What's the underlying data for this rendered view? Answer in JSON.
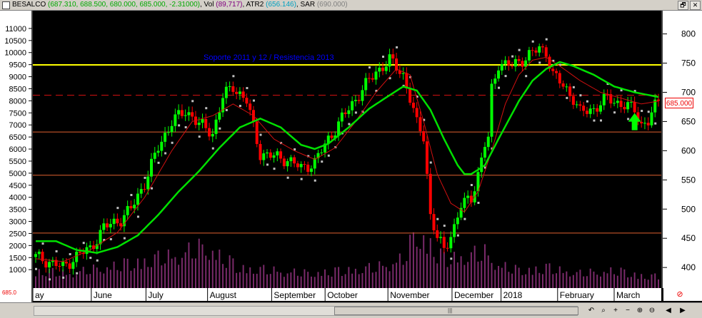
{
  "titlebar": {
    "symbol": "BESALCO",
    "ohlc": "(687.310, 688.500, 680.000, 685.000, -2.31000)",
    "vol_label": ", Vol",
    "vol_value": "(89,717)",
    "atr_label": ", ATR2",
    "atr_value": "(656.146)",
    "sar_label": ", SAR",
    "sar_value": "(690.000)",
    "restore_btn": "🗗",
    "close_btn": "✕"
  },
  "colors": {
    "background": "#000000",
    "up_candle": "#00ff00",
    "down_candle": "#ff0000",
    "volume": "#7a2a6a",
    "long_ma": "#00e000",
    "short_ma": "#d01010",
    "resistance": "#ffff00",
    "support": "#e06030",
    "annotation": "#0000ff",
    "arrow": "#00ff00"
  },
  "annotation": "Soporte 2011 y 12 / Resistencia 2013",
  "price_tag": "685.000",
  "left_tag": "685.0",
  "arrow_icon": "up-arrow-icon",
  "no_icon_glyph": "⊘",
  "scroll": {
    "grip": "|||",
    "buttons": [
      "↶",
      "⌕",
      "+",
      "−",
      "⊕",
      "⊖",
      "◀",
      "▶"
    ]
  },
  "chart_data": {
    "type": "candlestick",
    "left_axis": {
      "range": [
        0,
        11500
      ],
      "ticks": [
        1000,
        1500,
        2000,
        2500,
        3000,
        3500,
        4000,
        4500,
        5000,
        5500,
        6000,
        6500,
        7000,
        7500,
        8000,
        8500,
        9000,
        9500,
        10000,
        10500,
        11000
      ]
    },
    "right_axis": {
      "range": [
        355,
        830
      ],
      "ticks": [
        400,
        450,
        500,
        550,
        600,
        650,
        700,
        750,
        800
      ]
    },
    "x_labels": [
      "ay",
      "June",
      "July",
      "August",
      "September",
      "October",
      "November",
      "December",
      "2018",
      "February",
      "March"
    ],
    "horizontal_lines": [
      {
        "value": 747,
        "kind": "resistance"
      },
      {
        "value": 695,
        "kind": "dashed"
      },
      {
        "value": 632,
        "kind": "support"
      },
      {
        "value": 558,
        "kind": "support"
      },
      {
        "value": 459,
        "kind": "support"
      }
    ],
    "price_path": [
      [
        0,
        418
      ],
      [
        4,
        410
      ],
      [
        8,
        400
      ],
      [
        12,
        420
      ],
      [
        16,
        432
      ],
      [
        20,
        468
      ],
      [
        25,
        483
      ],
      [
        28,
        500
      ],
      [
        32,
        545
      ],
      [
        36,
        605
      ],
      [
        40,
        650
      ],
      [
        44,
        667
      ],
      [
        46,
        660
      ],
      [
        48,
        645
      ],
      [
        52,
        630
      ],
      [
        55,
        692
      ],
      [
        58,
        710
      ],
      [
        62,
        685
      ],
      [
        64,
        640
      ],
      [
        66,
        595
      ],
      [
        70,
        590
      ],
      [
        74,
        585
      ],
      [
        78,
        570
      ],
      [
        82,
        580
      ],
      [
        86,
        620
      ],
      [
        90,
        655
      ],
      [
        92,
        672
      ],
      [
        96,
        705
      ],
      [
        100,
        735
      ],
      [
        104,
        755
      ],
      [
        108,
        730
      ],
      [
        110,
        690
      ],
      [
        112,
        645
      ],
      [
        114,
        625
      ],
      [
        115,
        560
      ],
      [
        116,
        490
      ],
      [
        118,
        450
      ],
      [
        120,
        430
      ],
      [
        123,
        470
      ],
      [
        125,
        505
      ],
      [
        128,
        520
      ],
      [
        130,
        560
      ],
      [
        132,
        610
      ],
      [
        133,
        620
      ],
      [
        134,
        705
      ],
      [
        136,
        750
      ],
      [
        140,
        745
      ],
      [
        144,
        760
      ],
      [
        148,
        775
      ],
      [
        150,
        770
      ],
      [
        152,
        730
      ],
      [
        156,
        705
      ],
      [
        158,
        690
      ],
      [
        160,
        665
      ],
      [
        164,
        672
      ],
      [
        168,
        690
      ],
      [
        172,
        680
      ],
      [
        176,
        670
      ],
      [
        178,
        645
      ],
      [
        180,
        650
      ],
      [
        182,
        675
      ],
      [
        183,
        685
      ]
    ],
    "volume_path": [
      [
        0,
        0.3
      ],
      [
        10,
        0.25
      ],
      [
        20,
        0.35
      ],
      [
        30,
        0.45
      ],
      [
        40,
        0.55
      ],
      [
        50,
        0.7
      ],
      [
        60,
        0.35
      ],
      [
        70,
        0.3
      ],
      [
        80,
        0.25
      ],
      [
        90,
        0.3
      ],
      [
        100,
        0.35
      ],
      [
        108,
        0.5
      ],
      [
        112,
        0.95
      ],
      [
        116,
        0.75
      ],
      [
        120,
        0.5
      ],
      [
        126,
        0.55
      ],
      [
        132,
        0.6
      ],
      [
        136,
        0.4
      ],
      [
        142,
        0.3
      ],
      [
        150,
        0.35
      ],
      [
        160,
        0.25
      ],
      [
        170,
        0.3
      ],
      [
        180,
        0.2
      ],
      [
        183,
        0.2
      ]
    ],
    "long_ma_path": [
      [
        0,
        445
      ],
      [
        6,
        445
      ],
      [
        12,
        430
      ],
      [
        18,
        425
      ],
      [
        24,
        435
      ],
      [
        30,
        455
      ],
      [
        36,
        490
      ],
      [
        42,
        530
      ],
      [
        48,
        565
      ],
      [
        54,
        605
      ],
      [
        60,
        640
      ],
      [
        66,
        655
      ],
      [
        72,
        640
      ],
      [
        78,
        610
      ],
      [
        82,
        603
      ],
      [
        86,
        612
      ],
      [
        92,
        640
      ],
      [
        98,
        672
      ],
      [
        104,
        695
      ],
      [
        108,
        710
      ],
      [
        112,
        703
      ],
      [
        116,
        670
      ],
      [
        120,
        620
      ],
      [
        124,
        575
      ],
      [
        126,
        560
      ],
      [
        128,
        560
      ],
      [
        132,
        575
      ],
      [
        136,
        620
      ],
      [
        142,
        685
      ],
      [
        146,
        720
      ],
      [
        150,
        740
      ],
      [
        154,
        752
      ],
      [
        158,
        745
      ],
      [
        164,
        730
      ],
      [
        170,
        710
      ],
      [
        176,
        700
      ],
      [
        183,
        692
      ]
    ],
    "short_ma_path": [
      [
        0,
        415
      ],
      [
        8,
        410
      ],
      [
        16,
        430
      ],
      [
        24,
        460
      ],
      [
        32,
        520
      ],
      [
        40,
        600
      ],
      [
        46,
        650
      ],
      [
        52,
        660
      ],
      [
        58,
        680
      ],
      [
        64,
        660
      ],
      [
        70,
        620
      ],
      [
        76,
        600
      ],
      [
        82,
        585
      ],
      [
        88,
        605
      ],
      [
        94,
        650
      ],
      [
        100,
        700
      ],
      [
        106,
        740
      ],
      [
        110,
        730
      ],
      [
        114,
        650
      ],
      [
        118,
        560
      ],
      [
        122,
        510
      ],
      [
        126,
        495
      ],
      [
        130,
        530
      ],
      [
        134,
        600
      ],
      [
        138,
        680
      ],
      [
        142,
        730
      ],
      [
        146,
        755
      ],
      [
        150,
        760
      ],
      [
        154,
        745
      ],
      [
        160,
        720
      ],
      [
        166,
        700
      ],
      [
        172,
        690
      ],
      [
        178,
        680
      ],
      [
        183,
        685
      ]
    ]
  }
}
